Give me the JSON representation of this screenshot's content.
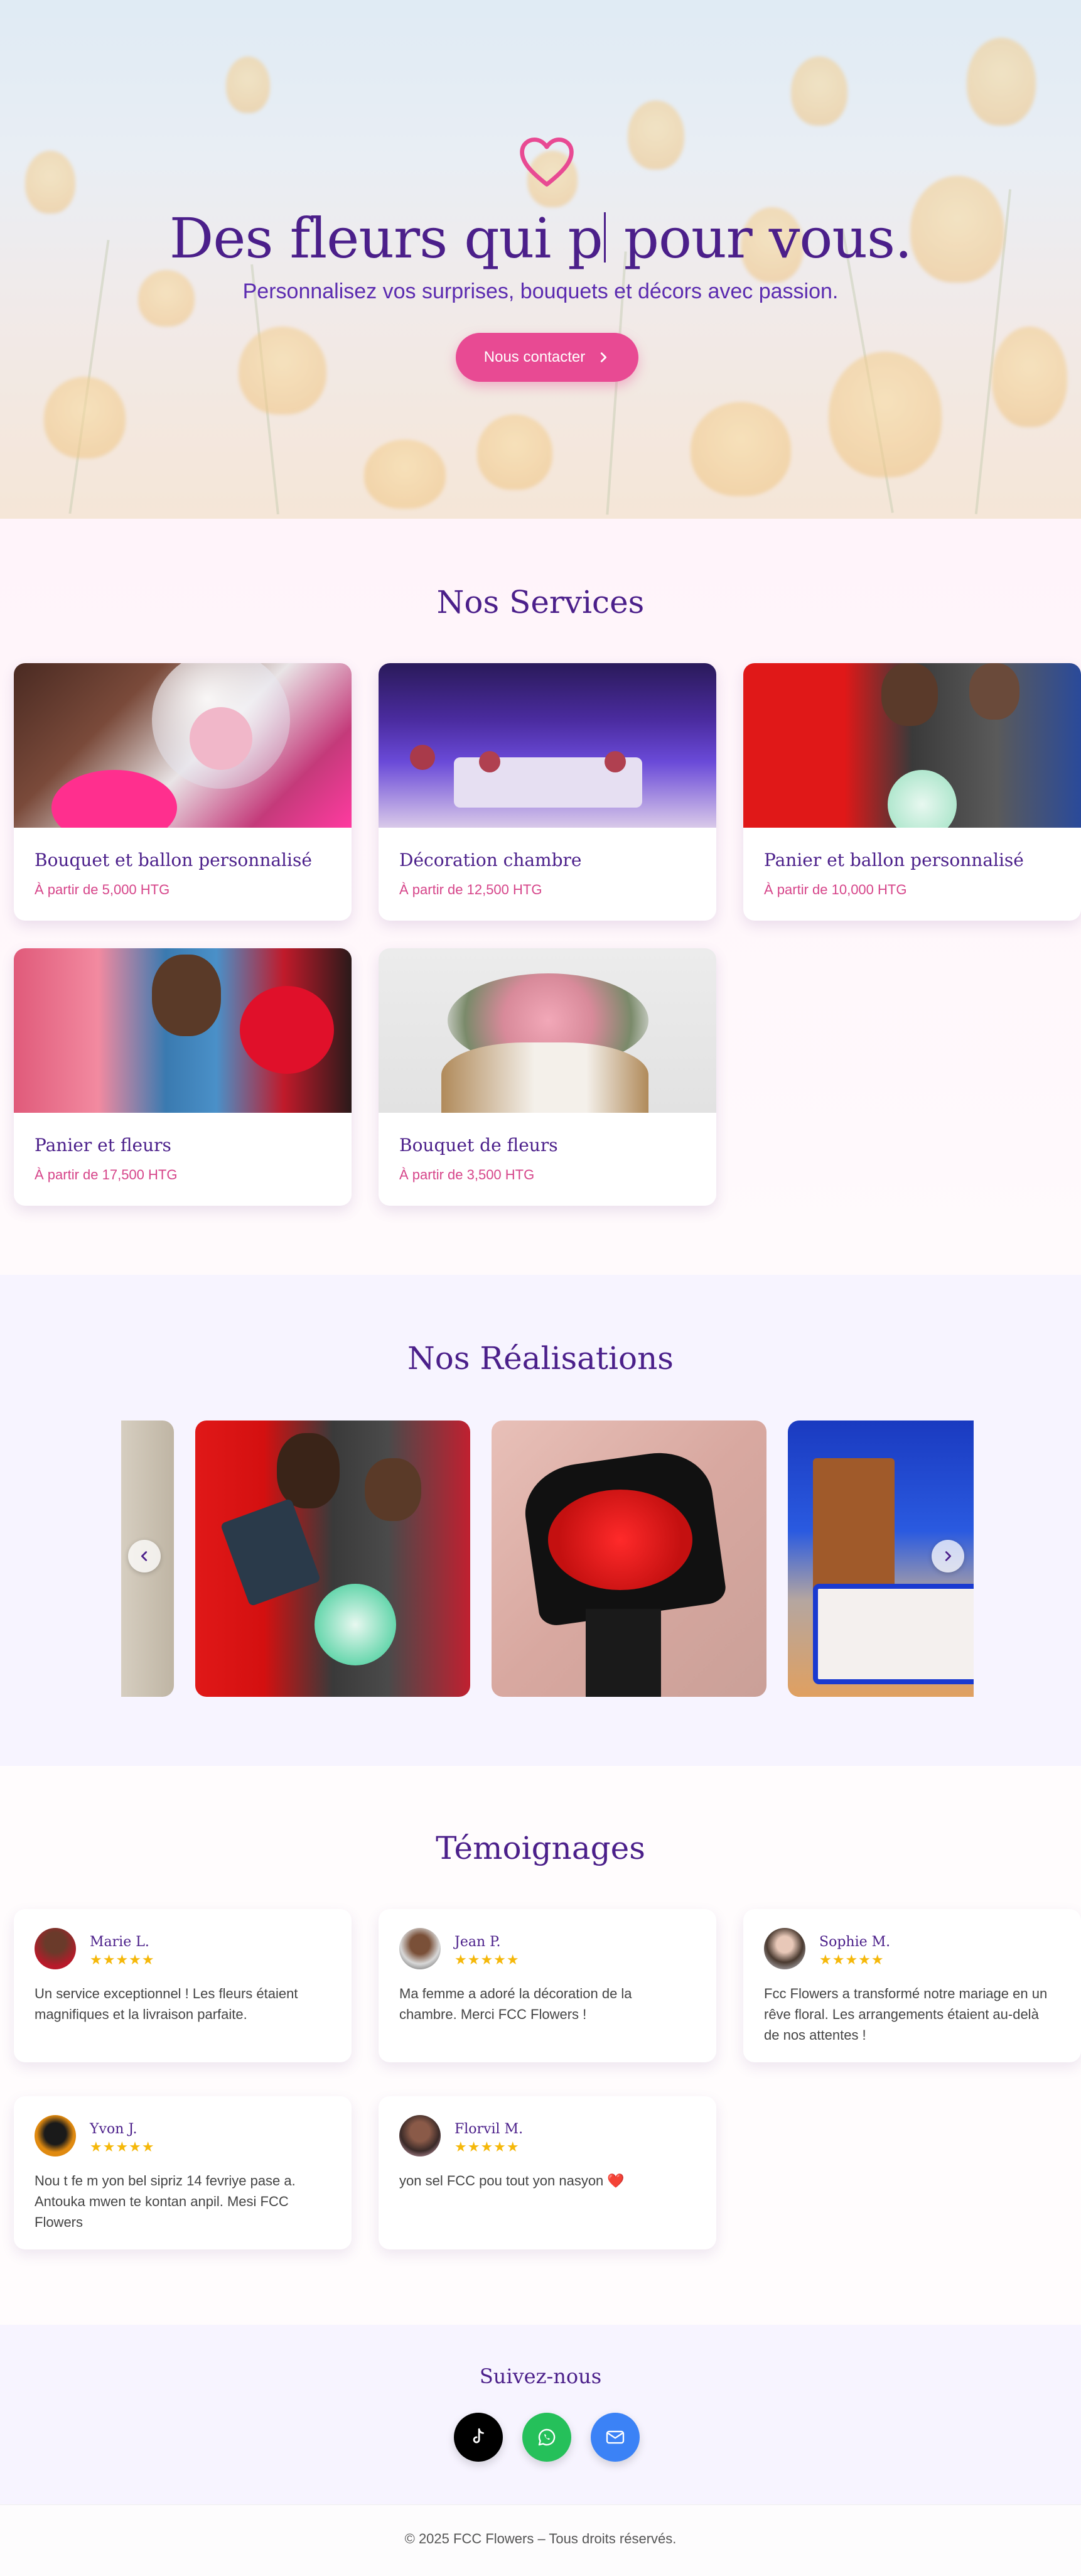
{
  "hero": {
    "title_before": "Des fleurs qui p",
    "title_after": " pour vous.",
    "subtitle": "Personnalisez vos surprises, bouquets et décors avec passion.",
    "cta_label": "Nous contacter",
    "heart_icon": "heart-outline-icon",
    "accent_color": "#e84a93"
  },
  "services": {
    "title": "Nos Services",
    "items": [
      {
        "name": "Bouquet et ballon personnalisé",
        "price": "À partir de 5,000 HTG"
      },
      {
        "name": "Décoration chambre",
        "price": "À partir de 12,500 HTG"
      },
      {
        "name": "Panier et ballon personnalisé",
        "price": "À partir de 10,000 HTG"
      },
      {
        "name": "Panier et fleurs",
        "price": "À partir de 17,500 HTG"
      },
      {
        "name": "Bouquet de fleurs",
        "price": "À partir de 3,500 HTG"
      }
    ]
  },
  "works": {
    "title": "Nos Réalisations",
    "prev_icon": "chevron-left-icon",
    "next_icon": "chevron-right-icon"
  },
  "testimonials": {
    "title": "Témoignages",
    "items": [
      {
        "name": "Marie L.",
        "stars": "★★★★★",
        "text": "Un service exceptionnel ! Les fleurs étaient magnifiques et la livraison parfaite."
      },
      {
        "name": "Jean P.",
        "stars": "★★★★★",
        "text": "Ma femme a adoré la décoration de la chambre. Merci FCC Flowers !"
      },
      {
        "name": "Sophie M.",
        "stars": "★★★★★",
        "text": "Fcc Flowers a transformé notre mariage en un rêve floral. Les arrangements étaient au-delà de nos attentes !"
      },
      {
        "name": "Yvon J.",
        "stars": "★★★★★",
        "text": "Nou t fe m yon bel sipriz 14 fevriye pase a. Antouka mwen te kontan anpil. Mesi FCC Flowers"
      },
      {
        "name": "Florvil M.",
        "stars": "★★★★★",
        "text": "yon sel FCC pou tout yon nasyon ❤️"
      }
    ]
  },
  "follow": {
    "title": "Suivez-nous",
    "socials": [
      {
        "icon": "tiktok-icon",
        "color": "#000000"
      },
      {
        "icon": "whatsapp-icon",
        "color": "#25c05a"
      },
      {
        "icon": "email-icon",
        "color": "#3b82f6"
      }
    ]
  },
  "footer": {
    "text": "© 2025 FCC Flowers – Tous droits réservés."
  }
}
